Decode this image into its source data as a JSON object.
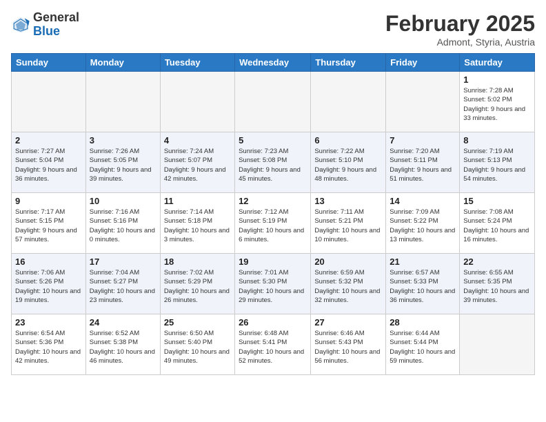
{
  "logo": {
    "general": "General",
    "blue": "Blue"
  },
  "header": {
    "month_year": "February 2025",
    "location": "Admont, Styria, Austria"
  },
  "days_of_week": [
    "Sunday",
    "Monday",
    "Tuesday",
    "Wednesday",
    "Thursday",
    "Friday",
    "Saturday"
  ],
  "weeks": [
    [
      {
        "num": "",
        "info": ""
      },
      {
        "num": "",
        "info": ""
      },
      {
        "num": "",
        "info": ""
      },
      {
        "num": "",
        "info": ""
      },
      {
        "num": "",
        "info": ""
      },
      {
        "num": "",
        "info": ""
      },
      {
        "num": "1",
        "info": "Sunrise: 7:28 AM\nSunset: 5:02 PM\nDaylight: 9 hours and 33 minutes."
      }
    ],
    [
      {
        "num": "2",
        "info": "Sunrise: 7:27 AM\nSunset: 5:04 PM\nDaylight: 9 hours and 36 minutes."
      },
      {
        "num": "3",
        "info": "Sunrise: 7:26 AM\nSunset: 5:05 PM\nDaylight: 9 hours and 39 minutes."
      },
      {
        "num": "4",
        "info": "Sunrise: 7:24 AM\nSunset: 5:07 PM\nDaylight: 9 hours and 42 minutes."
      },
      {
        "num": "5",
        "info": "Sunrise: 7:23 AM\nSunset: 5:08 PM\nDaylight: 9 hours and 45 minutes."
      },
      {
        "num": "6",
        "info": "Sunrise: 7:22 AM\nSunset: 5:10 PM\nDaylight: 9 hours and 48 minutes."
      },
      {
        "num": "7",
        "info": "Sunrise: 7:20 AM\nSunset: 5:11 PM\nDaylight: 9 hours and 51 minutes."
      },
      {
        "num": "8",
        "info": "Sunrise: 7:19 AM\nSunset: 5:13 PM\nDaylight: 9 hours and 54 minutes."
      }
    ],
    [
      {
        "num": "9",
        "info": "Sunrise: 7:17 AM\nSunset: 5:15 PM\nDaylight: 9 hours and 57 minutes."
      },
      {
        "num": "10",
        "info": "Sunrise: 7:16 AM\nSunset: 5:16 PM\nDaylight: 10 hours and 0 minutes."
      },
      {
        "num": "11",
        "info": "Sunrise: 7:14 AM\nSunset: 5:18 PM\nDaylight: 10 hours and 3 minutes."
      },
      {
        "num": "12",
        "info": "Sunrise: 7:12 AM\nSunset: 5:19 PM\nDaylight: 10 hours and 6 minutes."
      },
      {
        "num": "13",
        "info": "Sunrise: 7:11 AM\nSunset: 5:21 PM\nDaylight: 10 hours and 10 minutes."
      },
      {
        "num": "14",
        "info": "Sunrise: 7:09 AM\nSunset: 5:22 PM\nDaylight: 10 hours and 13 minutes."
      },
      {
        "num": "15",
        "info": "Sunrise: 7:08 AM\nSunset: 5:24 PM\nDaylight: 10 hours and 16 minutes."
      }
    ],
    [
      {
        "num": "16",
        "info": "Sunrise: 7:06 AM\nSunset: 5:26 PM\nDaylight: 10 hours and 19 minutes."
      },
      {
        "num": "17",
        "info": "Sunrise: 7:04 AM\nSunset: 5:27 PM\nDaylight: 10 hours and 23 minutes."
      },
      {
        "num": "18",
        "info": "Sunrise: 7:02 AM\nSunset: 5:29 PM\nDaylight: 10 hours and 26 minutes."
      },
      {
        "num": "19",
        "info": "Sunrise: 7:01 AM\nSunset: 5:30 PM\nDaylight: 10 hours and 29 minutes."
      },
      {
        "num": "20",
        "info": "Sunrise: 6:59 AM\nSunset: 5:32 PM\nDaylight: 10 hours and 32 minutes."
      },
      {
        "num": "21",
        "info": "Sunrise: 6:57 AM\nSunset: 5:33 PM\nDaylight: 10 hours and 36 minutes."
      },
      {
        "num": "22",
        "info": "Sunrise: 6:55 AM\nSunset: 5:35 PM\nDaylight: 10 hours and 39 minutes."
      }
    ],
    [
      {
        "num": "23",
        "info": "Sunrise: 6:54 AM\nSunset: 5:36 PM\nDaylight: 10 hours and 42 minutes."
      },
      {
        "num": "24",
        "info": "Sunrise: 6:52 AM\nSunset: 5:38 PM\nDaylight: 10 hours and 46 minutes."
      },
      {
        "num": "25",
        "info": "Sunrise: 6:50 AM\nSunset: 5:40 PM\nDaylight: 10 hours and 49 minutes."
      },
      {
        "num": "26",
        "info": "Sunrise: 6:48 AM\nSunset: 5:41 PM\nDaylight: 10 hours and 52 minutes."
      },
      {
        "num": "27",
        "info": "Sunrise: 6:46 AM\nSunset: 5:43 PM\nDaylight: 10 hours and 56 minutes."
      },
      {
        "num": "28",
        "info": "Sunrise: 6:44 AM\nSunset: 5:44 PM\nDaylight: 10 hours and 59 minutes."
      },
      {
        "num": "",
        "info": ""
      }
    ]
  ]
}
